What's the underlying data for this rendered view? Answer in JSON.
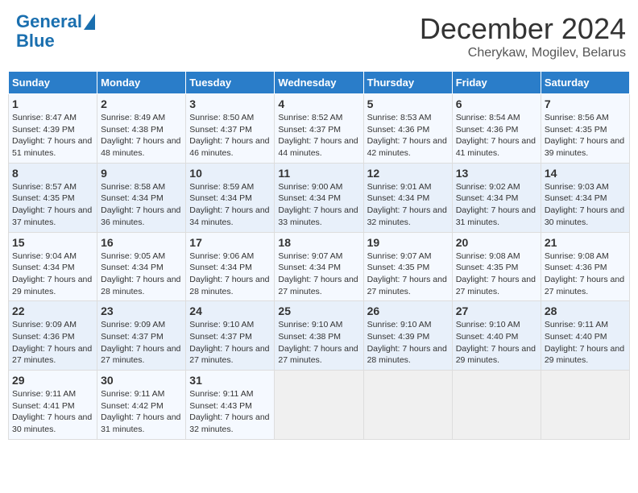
{
  "header": {
    "logo_line1": "General",
    "logo_line2": "Blue",
    "month": "December 2024",
    "location": "Cherykaw, Mogilev, Belarus"
  },
  "weekdays": [
    "Sunday",
    "Monday",
    "Tuesday",
    "Wednesday",
    "Thursday",
    "Friday",
    "Saturday"
  ],
  "weeks": [
    [
      {
        "day": "1",
        "sunrise": "8:47 AM",
        "sunset": "4:39 PM",
        "daylight": "7 hours and 51 minutes."
      },
      {
        "day": "2",
        "sunrise": "8:49 AM",
        "sunset": "4:38 PM",
        "daylight": "7 hours and 48 minutes."
      },
      {
        "day": "3",
        "sunrise": "8:50 AM",
        "sunset": "4:37 PM",
        "daylight": "7 hours and 46 minutes."
      },
      {
        "day": "4",
        "sunrise": "8:52 AM",
        "sunset": "4:37 PM",
        "daylight": "7 hours and 44 minutes."
      },
      {
        "day": "5",
        "sunrise": "8:53 AM",
        "sunset": "4:36 PM",
        "daylight": "7 hours and 42 minutes."
      },
      {
        "day": "6",
        "sunrise": "8:54 AM",
        "sunset": "4:36 PM",
        "daylight": "7 hours and 41 minutes."
      },
      {
        "day": "7",
        "sunrise": "8:56 AM",
        "sunset": "4:35 PM",
        "daylight": "7 hours and 39 minutes."
      }
    ],
    [
      {
        "day": "8",
        "sunrise": "8:57 AM",
        "sunset": "4:35 PM",
        "daylight": "7 hours and 37 minutes."
      },
      {
        "day": "9",
        "sunrise": "8:58 AM",
        "sunset": "4:34 PM",
        "daylight": "7 hours and 36 minutes."
      },
      {
        "day": "10",
        "sunrise": "8:59 AM",
        "sunset": "4:34 PM",
        "daylight": "7 hours and 34 minutes."
      },
      {
        "day": "11",
        "sunrise": "9:00 AM",
        "sunset": "4:34 PM",
        "daylight": "7 hours and 33 minutes."
      },
      {
        "day": "12",
        "sunrise": "9:01 AM",
        "sunset": "4:34 PM",
        "daylight": "7 hours and 32 minutes."
      },
      {
        "day": "13",
        "sunrise": "9:02 AM",
        "sunset": "4:34 PM",
        "daylight": "7 hours and 31 minutes."
      },
      {
        "day": "14",
        "sunrise": "9:03 AM",
        "sunset": "4:34 PM",
        "daylight": "7 hours and 30 minutes."
      }
    ],
    [
      {
        "day": "15",
        "sunrise": "9:04 AM",
        "sunset": "4:34 PM",
        "daylight": "7 hours and 29 minutes."
      },
      {
        "day": "16",
        "sunrise": "9:05 AM",
        "sunset": "4:34 PM",
        "daylight": "7 hours and 28 minutes."
      },
      {
        "day": "17",
        "sunrise": "9:06 AM",
        "sunset": "4:34 PM",
        "daylight": "7 hours and 28 minutes."
      },
      {
        "day": "18",
        "sunrise": "9:07 AM",
        "sunset": "4:34 PM",
        "daylight": "7 hours and 27 minutes."
      },
      {
        "day": "19",
        "sunrise": "9:07 AM",
        "sunset": "4:35 PM",
        "daylight": "7 hours and 27 minutes."
      },
      {
        "day": "20",
        "sunrise": "9:08 AM",
        "sunset": "4:35 PM",
        "daylight": "7 hours and 27 minutes."
      },
      {
        "day": "21",
        "sunrise": "9:08 AM",
        "sunset": "4:36 PM",
        "daylight": "7 hours and 27 minutes."
      }
    ],
    [
      {
        "day": "22",
        "sunrise": "9:09 AM",
        "sunset": "4:36 PM",
        "daylight": "7 hours and 27 minutes."
      },
      {
        "day": "23",
        "sunrise": "9:09 AM",
        "sunset": "4:37 PM",
        "daylight": "7 hours and 27 minutes."
      },
      {
        "day": "24",
        "sunrise": "9:10 AM",
        "sunset": "4:37 PM",
        "daylight": "7 hours and 27 minutes."
      },
      {
        "day": "25",
        "sunrise": "9:10 AM",
        "sunset": "4:38 PM",
        "daylight": "7 hours and 27 minutes."
      },
      {
        "day": "26",
        "sunrise": "9:10 AM",
        "sunset": "4:39 PM",
        "daylight": "7 hours and 28 minutes."
      },
      {
        "day": "27",
        "sunrise": "9:10 AM",
        "sunset": "4:40 PM",
        "daylight": "7 hours and 29 minutes."
      },
      {
        "day": "28",
        "sunrise": "9:11 AM",
        "sunset": "4:40 PM",
        "daylight": "7 hours and 29 minutes."
      }
    ],
    [
      {
        "day": "29",
        "sunrise": "9:11 AM",
        "sunset": "4:41 PM",
        "daylight": "7 hours and 30 minutes."
      },
      {
        "day": "30",
        "sunrise": "9:11 AM",
        "sunset": "4:42 PM",
        "daylight": "7 hours and 31 minutes."
      },
      {
        "day": "31",
        "sunrise": "9:11 AM",
        "sunset": "4:43 PM",
        "daylight": "7 hours and 32 minutes."
      },
      null,
      null,
      null,
      null
    ]
  ]
}
